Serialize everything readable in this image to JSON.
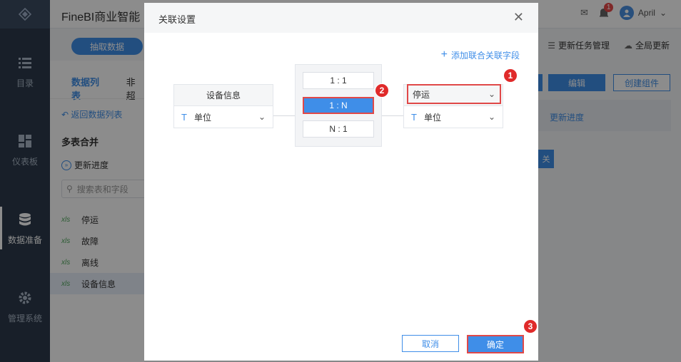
{
  "app": {
    "title": "FineBI商业智能"
  },
  "header": {
    "notif_count": "1",
    "user_name": "April"
  },
  "toolbar": {
    "extract_btn": "抽取数据",
    "task_mgmt": "更新任务管理",
    "global_update": "全局更新"
  },
  "nav": {
    "items": [
      {
        "label": "目录"
      },
      {
        "label": "仪表板"
      },
      {
        "label": "数据准备"
      },
      {
        "label": "管理系统"
      }
    ]
  },
  "panel": {
    "tabs": [
      {
        "label": "数据列表"
      },
      {
        "label": "非超"
      }
    ],
    "back_label": "返回数据列表",
    "group_title": "多表合并",
    "progress_label": "更新进度",
    "search_placeholder": "搜索表和字段",
    "tables": [
      {
        "label": "停运",
        "icon": "xls"
      },
      {
        "label": "故障",
        "icon": "xls"
      },
      {
        "label": "离线",
        "icon": "xls"
      },
      {
        "label": "设备信息",
        "icon": "xls"
      }
    ]
  },
  "right": {
    "edit_btn": "编辑",
    "create_btn": "创建组件",
    "progress_label": "更新进度",
    "partial_btn": "关"
  },
  "dialog": {
    "title": "关联设置",
    "add_link": "添加联合关联字段",
    "left_table": {
      "name": "设备信息",
      "field": "单位",
      "field_type_icon": "T"
    },
    "options": [
      {
        "label": "1 : 1"
      },
      {
        "label": "1 : N"
      },
      {
        "label": "N : 1"
      }
    ],
    "right_table": {
      "name": "停运",
      "field": "单位",
      "field_type_icon": "T"
    },
    "cancel_btn": "取消",
    "ok_btn": "确定"
  },
  "markers": [
    "1",
    "2",
    "3"
  ],
  "colors": {
    "accent": "#3f8ee8",
    "highlight": "#e04848",
    "nav_bg": "#2d3a4b"
  }
}
